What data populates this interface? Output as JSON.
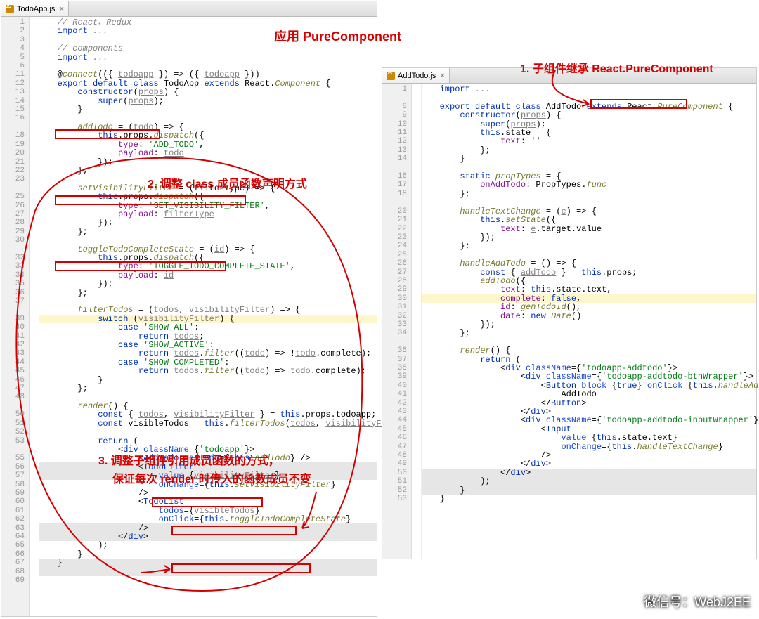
{
  "title_main": "应用 PureComponent",
  "anno1": "1. 子组件继承 React.PureComponent",
  "anno2": "2. 调整 class 成员函数声明方式",
  "anno3a": "3. 调整子组件引用成员函数的方式，",
  "anno3b": "保证每次 render 时传入的函数成员不变",
  "watermark": "微信号：WebJ2EE",
  "left": {
    "tab": "TodoApp.js",
    "first_line": 1,
    "last_line": 69,
    "code_html": "   <span class='c-cm2'>// React、Redux</span>\n   <span class='c-kw'>import</span> <span class='c-cm'>...</span>\n\n   <span class='c-cm2'>// components</span>\n   <span class='c-kw'>import</span> <span class='c-cm'>...</span>\n\n   @<span class='c-fn'>connect</span>(({ <span class='c-ul'>todoapp</span> }) => ({ <span class='c-ul'>todoapp</span> }))\n   <span class='c-kw'>export default class</span> TodoApp <span class='c-kw'>extends</span> React.<span class='c-fn'>Component</span> {\n       <span class='c-kw'>constructor</span>(<span class='c-ul'>props</span>) {\n           <span class='c-kw'>super</span>(<span class='c-ul'>props</span>);\n       }\n\n       <span class='c-fn'>addTodo</span> = (<span class='c-ul'>todo</span>) => {\n           <span class='c-kw'>this</span>.props.<span class='c-fn'>dispatch</span>({\n               <span class='c-prop'>type</span>: <span class='c-str'>'ADD_TODO'</span>,\n               <span class='c-prop'>payload</span>: <span class='c-ul'>todo</span>\n           });\n       };\n\n       <span class='c-fn'>setVisibilityFilter</span> = (filterType) => {\n           <span class='c-kw'>this</span>.props.<span class='c-fn'>dispatch</span>({\n               <span class='c-prop'>type</span>: <span class='c-str'>'SET_VISIBILITY_FILTER'</span>,\n               <span class='c-prop'>payload</span>: <span class='c-ul'>filterType</span>\n           });\n       };\n\n       <span class='c-fn'>toggleTodoCompleteState</span> = (<span class='c-ul'>id</span>) => {\n           <span class='c-kw'>this</span>.props.<span class='c-fn'>dispatch</span>({\n               <span class='c-prop'>type</span>: <span class='c-str'>'TOGGLE_TODO_COMPLETE_STATE'</span>,\n               <span class='c-prop'>payload</span>: <span class='c-ul'>id</span>\n           });\n       };\n\n       <span class='c-fn'>filterTodos</span> = (<span class='c-ul'>todos</span>, <span class='c-ul'>visibilityFilter</span>) => {\n           <span class='c-kw'>switch</span> (<span class='c-ul'>visibilityFilter</span>) {\n               <span class='c-kw'>case</span> <span class='c-str'>'SHOW_ALL'</span>:\n                   <span class='c-kw'>return</span> <span class='c-ul'>todos</span>;\n               <span class='c-kw'>case</span> <span class='c-str'>'SHOW_ACTIVE'</span>:\n                   <span class='c-kw'>return</span> <span class='c-ul'>todos</span>.<span class='c-fn'>filter</span>((<span class='c-ul'>todo</span>) => !<span class='c-ul'>todo</span>.complete);\n               <span class='c-kw'>case</span> <span class='c-str'>'SHOW_COMPLETED'</span>:\n                   <span class='c-kw'>return</span> <span class='c-ul'>todos</span>.<span class='c-fn'>filter</span>((<span class='c-ul'>todo</span>) => <span class='c-ul'>todo</span>.complete);\n           }\n       };\n\n       <span class='c-fn'>render</span>() {\n           <span class='c-kw'>const</span> { <span class='c-ul'>todos</span>, <span class='c-ul'>visibilityFilter</span> } = <span class='c-kw'>this</span>.props.todoapp;\n           <span class='c-kw'>const</span> visibleTodos = <span class='c-kw'>this</span>.<span class='c-fn'>filterTodos</span>(<span class='c-ul'>todos</span>, <span class='c-ul'>visibilityFilter</span>);\n\n           <span class='c-kw'>return</span> (\n               &lt;<span class='c-tag'>div</span> <span class='c-attr'>className</span>={<span class='c-str'>'todoapp'</span>}&gt;\n                   &lt;<span class='c-tag'>AddTodo</span> <span class='c-attr'>addTodo</span>={<span class='c-kw'>this</span>.<span class='c-fn'>addTodo</span>} /&gt;\n                   &lt;<span class='c-tag'>TodoFilter</span>\n                       <span class='c-attr'>value</span>={<span class='c-ul'>visibilityFilter</span>}\n                       <span class='c-attr'>onChange</span>={<span class='c-kw'>this</span>.<span class='c-fn'>setVisibilityFilter</span>}\n                   /&gt;\n                   &lt;<span class='c-tag'>TodoList</span>\n                       <span class='c-attr'>todos</span>={<span class='c-ul'>visibleTodos</span>}\n                       <span class='c-attr'>onClick</span>={<span class='c-kw'>this</span>.<span class='c-fn'>toggleTodoCompleteState</span>}\n                   /&gt;\n               &lt;/<span class='c-tag'>div</span>&gt;\n           );\n       }\n   }"
  },
  "right": {
    "tab": "AddTodo.js",
    "first_line": 1,
    "last_line": 53,
    "code_html": "   <span class='c-kw'>import</span> <span class='c-cm'>...</span>\n\n   <span class='c-kw'>export default class</span> AddTodo <span class='c-kw'>extends</span> React.<span class='c-fn'>PureComponent</span> {\n       <span class='c-kw'>constructor</span>(<span class='c-ul'>props</span>) {\n           <span class='c-kw'>super</span>(<span class='c-ul'>props</span>);\n           <span class='c-kw'>this</span>.state = {\n               <span class='c-prop'>text</span>: <span class='c-str'>''</span>\n           };\n       }\n\n       <span class='c-kw'>static</span> <span class='c-fn'>propTypes</span> = {\n           <span class='c-prop'>onAddTodo</span>: PropTypes.<span class='c-fn'>func</span>\n       };\n\n       <span class='c-fn'>handleTextChange</span> = (<span class='c-ul'>e</span>) => {\n           <span class='c-kw'>this</span>.<span class='c-fn'>setState</span>({\n               <span class='c-prop'>text</span>: <span class='c-ul'>e</span>.target.value\n           });\n       };\n\n       <span class='c-fn'>handleAddTodo</span> = () => {\n           <span class='c-kw'>const</span> { <span class='c-ul'>addTodo</span> } = <span class='c-kw'>this</span>.props;\n           <span class='c-fn'>addTodo</span>({\n               <span class='c-prop'>text</span>: <span class='c-kw'>this</span>.state.text,\n               <span class='c-prop'>complete</span>: <span class='c-kw'>false</span>,\n               <span class='c-prop'>id</span>: <span class='c-fn'>genTodoId</span>(),\n               <span class='c-prop'>date</span>: <span class='c-kw'>new</span> <span class='c-fn'>Date</span>()\n           });\n       };\n\n       <span class='c-fn'>render</span>() {\n           <span class='c-kw'>return</span> (\n               &lt;<span class='c-tag'>div</span> <span class='c-attr'>className</span>={<span class='c-str'>'todoapp-addtodo'</span>}&gt;\n                   &lt;<span class='c-tag'>div</span> <span class='c-attr'>className</span>={<span class='c-str'>'todoapp-addtodo-btnWrapper'</span>}&gt;\n                       &lt;<span class='c-tag'>Button</span> <span class='c-attr'>block</span>={<span class='c-kw'>true</span>} <span class='c-attr'>onClick</span>={<span class='c-kw'>this</span>.<span class='c-fn'>handleAddTodo</span>}&gt;\n                           AddTodo\n                       &lt;/<span class='c-tag'>Button</span>&gt;\n                   &lt;/<span class='c-tag'>div</span>&gt;\n                   &lt;<span class='c-tag'>div</span> <span class='c-attr'>className</span>={<span class='c-str'>'todoapp-addtodo-inputWrapper'</span>}&gt;\n                       &lt;<span class='c-tag'>Input</span>\n                           <span class='c-attr'>value</span>={<span class='c-kw'>this</span>.state.text}\n                           <span class='c-attr'>onChange</span>={<span class='c-kw'>this</span>.<span class='c-fn'>handleTextChange</span>}\n                       /&gt;\n                   &lt;/<span class='c-tag'>div</span>&gt;\n               &lt;/<span class='c-tag'>div</span>&gt;\n           );\n       }\n   }"
  }
}
